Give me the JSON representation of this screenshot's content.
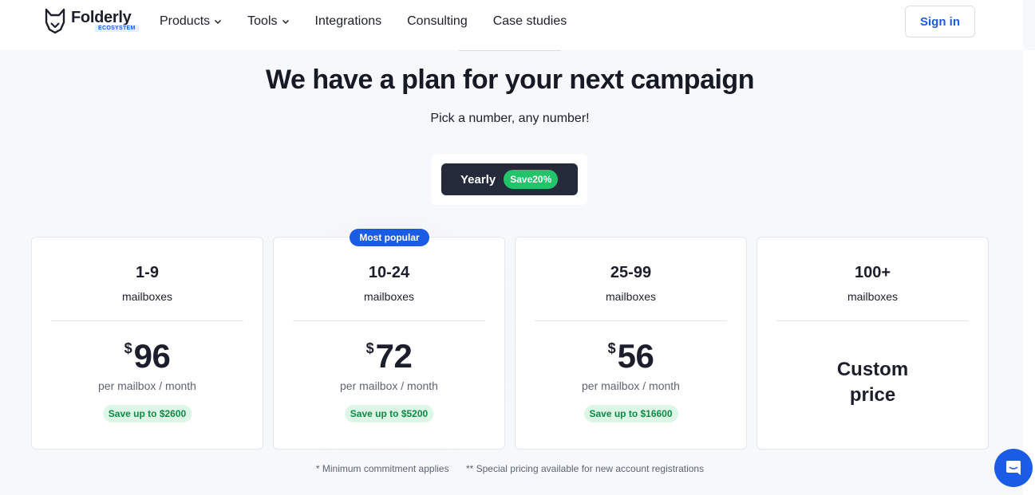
{
  "brand": {
    "name": "Folderly",
    "badge": "ECOSYSTEM"
  },
  "nav": [
    {
      "label": "Products",
      "dropdown": true
    },
    {
      "label": "Tools",
      "dropdown": true
    },
    {
      "label": "Integrations",
      "dropdown": false
    },
    {
      "label": "Consulting",
      "dropdown": false
    },
    {
      "label": "Case studies",
      "dropdown": false
    }
  ],
  "signin_label": "Sign in",
  "hero": {
    "title": "We have a plan for your next campaign",
    "subtitle": "Pick a number, any number!"
  },
  "billing_toggle": {
    "label": "Yearly",
    "save_badge": "Save20%"
  },
  "popular_badge": "Most popular",
  "plans": [
    {
      "range": "1-9",
      "unit": "mailboxes",
      "currency": "$",
      "price": "96",
      "per": "per mailbox / month",
      "save": "Save up to $2600"
    },
    {
      "range": "10-24",
      "unit": "mailboxes",
      "currency": "$",
      "price": "72",
      "per": "per mailbox / month",
      "save": "Save up to $5200"
    },
    {
      "range": "25-99",
      "unit": "mailboxes",
      "currency": "$",
      "price": "56",
      "per": "per mailbox / month",
      "save": "Save up to $16600"
    },
    {
      "range": "100+",
      "unit": "mailboxes",
      "custom_line1": "Custom",
      "custom_line2": "price"
    }
  ],
  "footnotes": [
    "* Minimum commitment applies",
    "** Special pricing available for new account registrations"
  ],
  "colors": {
    "accent": "#1a5ce6",
    "dark": "#242a3a",
    "green": "#22c36b"
  },
  "icons": {
    "logo": "fox-logo-icon",
    "chat": "chat-bubble-icon",
    "dropdown": "chevron-down-icon"
  }
}
